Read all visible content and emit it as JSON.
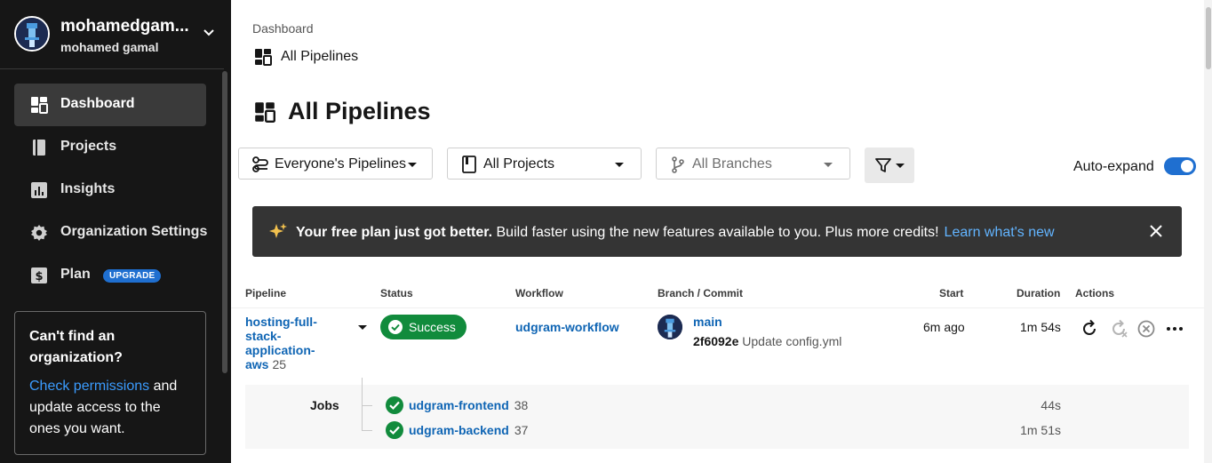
{
  "user": {
    "name": "mohamedgam...",
    "handle": "mohamed gamal"
  },
  "sidebar": {
    "items": [
      {
        "label": "Dashboard",
        "icon": "dashboard-icon",
        "active": true
      },
      {
        "label": "Projects",
        "icon": "book-icon"
      },
      {
        "label": "Insights",
        "icon": "chart-icon"
      },
      {
        "label": "Organization Settings",
        "icon": "gear-icon"
      },
      {
        "label": "Plan",
        "icon": "dollar-icon",
        "badge": "UPGRADE"
      }
    ],
    "org_box": {
      "title": "Can't find an organization?",
      "link": "Check permissions",
      "text_after": " and update access to the ones you want."
    }
  },
  "breadcrumb": {
    "root": "Dashboard",
    "current": "All Pipelines"
  },
  "page_title": "All Pipelines",
  "filters": {
    "pipelines": "Everyone's Pipelines",
    "projects": "All Projects",
    "branches": "All Branches",
    "auto_expand_label": "Auto-expand",
    "auto_expand_on": true
  },
  "banner": {
    "bold": "Your free plan just got better.",
    "text": " Build faster using the new features available to you. Plus more credits!",
    "link": "Learn what's new"
  },
  "table": {
    "headers": {
      "pipeline": "Pipeline",
      "status": "Status",
      "workflow": "Workflow",
      "branch_commit": "Branch / Commit",
      "start": "Start",
      "duration": "Duration",
      "actions": "Actions"
    },
    "row": {
      "pipeline": "hosting-full-stack-application-aws",
      "pipeline_number": "25",
      "status": "Success",
      "workflow": "udgram-workflow",
      "branch": "main",
      "commit_hash": "2f6092e",
      "commit_message": "Update config.yml",
      "start": "6m ago",
      "duration": "1m 54s"
    },
    "jobs_label": "Jobs",
    "jobs": [
      {
        "name": "udgram-frontend",
        "number": "38",
        "duration": "44s"
      },
      {
        "name": "udgram-backend",
        "number": "37",
        "duration": "1m 51s"
      }
    ]
  },
  "colors": {
    "sidebar_bg": "#161616",
    "link": "#0f65b4",
    "success": "#118b3c",
    "toggle": "#1f6fd0",
    "banner_bg": "#343434"
  }
}
